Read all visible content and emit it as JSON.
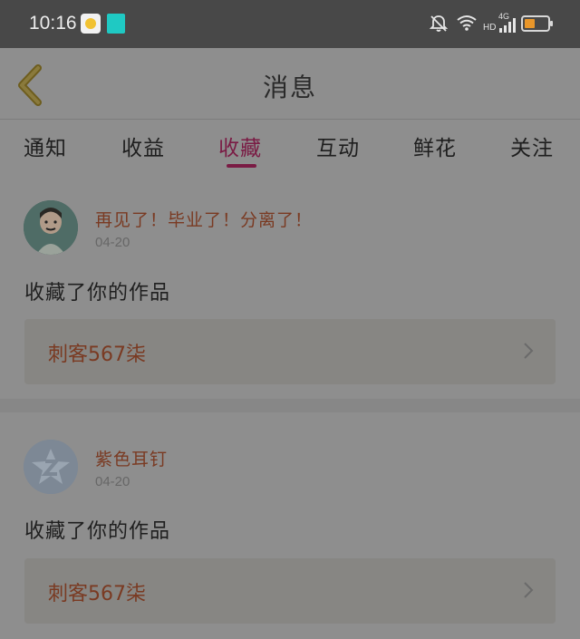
{
  "status_bar": {
    "time": "10:16",
    "network_hd": "HD",
    "network_4g": "4G"
  },
  "header": {
    "title": "消息"
  },
  "tabs": [
    {
      "label": "通知"
    },
    {
      "label": "收益"
    },
    {
      "label": "收藏"
    },
    {
      "label": "互动"
    },
    {
      "label": "鲜花"
    },
    {
      "label": "关注"
    }
  ],
  "active_tab": "收藏",
  "colors": {
    "accent": "#7a1b44",
    "username": "#7a3a22"
  },
  "messages": [
    {
      "user": "再见了！毕业了！分离了！",
      "date": "04-20",
      "action": "收藏了你的作品",
      "work_title": "刺客567柒"
    },
    {
      "user": "紫色耳钉",
      "date": "04-20",
      "action": "收藏了你的作品",
      "work_title": "刺客567柒"
    }
  ]
}
